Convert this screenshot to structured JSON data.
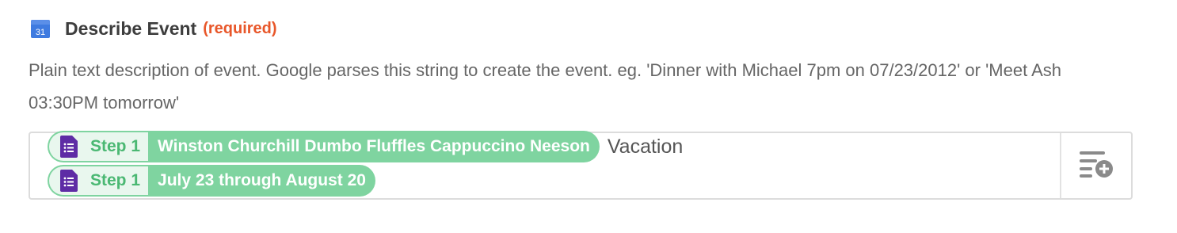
{
  "field": {
    "label": "Describe Event",
    "required_text": "(required)",
    "help_text": "Plain text description of event. Google parses this string to create the event. eg. 'Dinner with Michael 7pm on 07/23/2012' or 'Meet Ash 03:30PM tomorrow'",
    "icon": "google-calendar-icon",
    "calendar_day": "31"
  },
  "input": {
    "line1": {
      "pill": {
        "step": "Step 1",
        "value": "Winston Churchill Dumbo Fluffles Cappuccino Neeson",
        "icon": "google-forms-icon"
      },
      "trailing_text": "Vacation"
    },
    "line2": {
      "pill": {
        "step": "Step 1",
        "value": "July 23 through August 20",
        "icon": "google-forms-icon"
      }
    },
    "insert_button_icon": "insert-data-icon"
  },
  "colors": {
    "required": "#e8572a",
    "pill_bg": "#7fd4a0",
    "pill_step_bg": "#e9f7ee",
    "step_text": "#4bb873",
    "forms_purple": "#5e2ca5",
    "calendar_blue": "#3f7be0"
  }
}
